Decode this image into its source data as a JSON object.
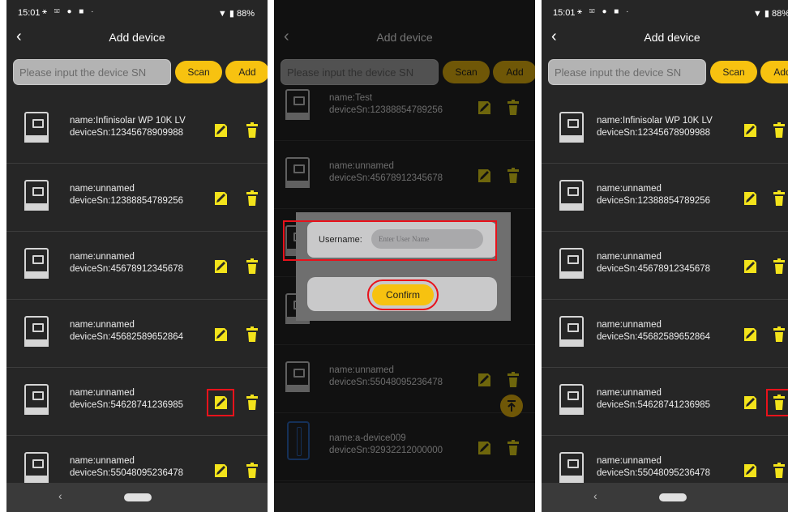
{
  "status_bar": {
    "time": "15:01",
    "battery": "88%"
  },
  "header": {
    "back": "‹",
    "title": "Add device"
  },
  "search": {
    "placeholder": "Please input the device SN",
    "scan_label": "Scan",
    "add_label": "Add"
  },
  "devices": [
    {
      "name": "name:Infinisolar WP 10K LV",
      "sn": "deviceSn:12345678909988"
    },
    {
      "name": "name:unnamed",
      "sn": "deviceSn:12388854789256"
    },
    {
      "name": "name:unnamed",
      "sn": "deviceSn:45678912345678"
    },
    {
      "name": "name:unnamed",
      "sn": "deviceSn:45682589652864"
    },
    {
      "name": "name:unnamed",
      "sn": "deviceSn:54628741236985"
    },
    {
      "name": "name:unnamed",
      "sn": "deviceSn:55048095236478"
    }
  ],
  "middle_devices": [
    {
      "name": "name:Test",
      "sn": "deviceSn:12388854789256"
    },
    {
      "name": "name:unnamed",
      "sn": "deviceSn:45678912345678"
    },
    {
      "name": "name:unnamed",
      "sn": "deviceSn:55048095236478"
    },
    {
      "name": "name:a-device009",
      "sn": "deviceSn:92932212000000"
    }
  ],
  "dialog": {
    "username_label": "Username:",
    "username_placeholder": "Enter User Name",
    "confirm_label": "Confirm"
  },
  "colors": {
    "accent": "#f7c210",
    "highlight": "#e8121b",
    "background": "#262626"
  },
  "icons": {
    "edit": "edit-icon",
    "delete": "trash-icon",
    "back": "chevron-left-icon",
    "scroll_top": "arrow-up-icon"
  }
}
